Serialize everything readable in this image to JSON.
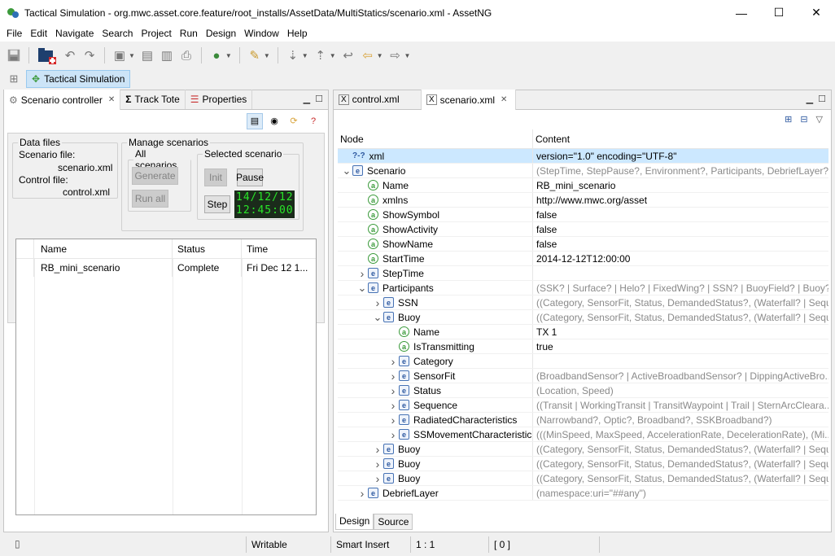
{
  "window": {
    "title": "Tactical Simulation - org.mwc.asset.core.feature/root_installs/AssetData/MultiStatics/scenario.xml - AssetNG",
    "minimize": "—",
    "maximize": "☐",
    "close": "✕"
  },
  "menu": [
    "File",
    "Edit",
    "Navigate",
    "Search",
    "Project",
    "Run",
    "Design",
    "Window",
    "Help"
  ],
  "perspective": {
    "label": "Tactical Simulation"
  },
  "left_view": {
    "tabs": [
      {
        "label": "Scenario controller",
        "active": true
      },
      {
        "label": "Track Tote",
        "active": false
      },
      {
        "label": "Properties",
        "active": false
      }
    ],
    "data_files": {
      "legend": "Data files",
      "scenario_label": "Scenario file:",
      "scenario_value": "scenario.xml",
      "control_label": "Control file:",
      "control_value": "control.xml"
    },
    "manage": {
      "legend": "Manage scenarios",
      "all_legend": "All scenarios",
      "generate": "Generate",
      "run_all": "Run all",
      "selected_legend": "Selected scenario",
      "init": "Init",
      "pause": "Pause",
      "step": "Step",
      "date": "14/12/12",
      "time": "12:45:00"
    },
    "table": {
      "columns": [
        "Name",
        "Status",
        "Time"
      ],
      "rows": [
        {
          "name": "RB_mini_scenario",
          "status": "Complete",
          "time": "Fri Dec 12 1..."
        }
      ]
    }
  },
  "editor": {
    "tabs": [
      {
        "label": "control.xml",
        "active": false
      },
      {
        "label": "scenario.xml",
        "active": true
      }
    ],
    "columns": [
      "Node",
      "Content"
    ],
    "rows": [
      {
        "depth": 0,
        "twisty": "",
        "kind": "pi",
        "name": "xml",
        "content": "version=\"1.0\" encoding=\"UTF-8\"",
        "grey": false,
        "selected": true
      },
      {
        "depth": 0,
        "twisty": "open",
        "kind": "elem",
        "name": "Scenario",
        "content": "(StepTime, StepPause?, Environment?, Participants, DebriefLayer?)",
        "grey": true
      },
      {
        "depth": 1,
        "twisty": "",
        "kind": "attr",
        "name": "Name",
        "content": "RB_mini_scenario",
        "grey": false
      },
      {
        "depth": 1,
        "twisty": "",
        "kind": "attr",
        "name": "xmlns",
        "content": "http://www.mwc.org/asset",
        "grey": false
      },
      {
        "depth": 1,
        "twisty": "",
        "kind": "attr",
        "name": "ShowSymbol",
        "content": "false",
        "grey": false
      },
      {
        "depth": 1,
        "twisty": "",
        "kind": "attr",
        "name": "ShowActivity",
        "content": "false",
        "grey": false
      },
      {
        "depth": 1,
        "twisty": "",
        "kind": "attr",
        "name": "ShowName",
        "content": "false",
        "grey": false
      },
      {
        "depth": 1,
        "twisty": "",
        "kind": "attr",
        "name": "StartTime",
        "content": "2014-12-12T12:00:00",
        "grey": false
      },
      {
        "depth": 1,
        "twisty": "closed",
        "kind": "elem",
        "name": "StepTime",
        "content": "",
        "grey": false
      },
      {
        "depth": 1,
        "twisty": "open",
        "kind": "elem",
        "name": "Participants",
        "content": "(SSK? | Surface? | Helo? | FixedWing? | SSN? | BuoyField? | Buoy? | T...",
        "grey": true
      },
      {
        "depth": 2,
        "twisty": "closed",
        "kind": "elem",
        "name": "SSN",
        "content": "((Category, SensorFit, Status, DemandedStatus?, (Waterfall? | Sequ...",
        "grey": true
      },
      {
        "depth": 2,
        "twisty": "open",
        "kind": "elem",
        "name": "Buoy",
        "content": "((Category, SensorFit, Status, DemandedStatus?, (Waterfall? | Sequ...",
        "grey": true
      },
      {
        "depth": 3,
        "twisty": "",
        "kind": "attr",
        "name": "Name",
        "content": "TX 1",
        "grey": false
      },
      {
        "depth": 3,
        "twisty": "",
        "kind": "attr",
        "name": "IsTransmitting",
        "content": "true",
        "grey": false
      },
      {
        "depth": 3,
        "twisty": "closed",
        "kind": "elem",
        "name": "Category",
        "content": "",
        "grey": false
      },
      {
        "depth": 3,
        "twisty": "closed",
        "kind": "elem",
        "name": "SensorFit",
        "content": "(BroadbandSensor? | ActiveBroadbandSensor? | DippingActiveBro...",
        "grey": true
      },
      {
        "depth": 3,
        "twisty": "closed",
        "kind": "elem",
        "name": "Status",
        "content": "(Location, Speed)",
        "grey": true
      },
      {
        "depth": 3,
        "twisty": "closed",
        "kind": "elem",
        "name": "Sequence",
        "content": "((Transit | WorkingTransit | TransitWaypoint | Trail | SternArcCleara...",
        "grey": true
      },
      {
        "depth": 3,
        "twisty": "closed",
        "kind": "elem",
        "name": "RadiatedCharacteristics",
        "content": "(Narrowband?, Optic?, Broadband?, SSKBroadband?)",
        "grey": true
      },
      {
        "depth": 3,
        "twisty": "closed",
        "kind": "elem",
        "name": "SSMovementCharacteristic",
        "content": "(((MinSpeed, MaxSpeed, AccelerationRate, DecelerationRate), (Mi...",
        "grey": true
      },
      {
        "depth": 2,
        "twisty": "closed",
        "kind": "elem",
        "name": "Buoy",
        "content": "((Category, SensorFit, Status, DemandedStatus?, (Waterfall? | Sequ...",
        "grey": true
      },
      {
        "depth": 2,
        "twisty": "closed",
        "kind": "elem",
        "name": "Buoy",
        "content": "((Category, SensorFit, Status, DemandedStatus?, (Waterfall? | Sequ...",
        "grey": true
      },
      {
        "depth": 2,
        "twisty": "closed",
        "kind": "elem",
        "name": "Buoy",
        "content": "((Category, SensorFit, Status, DemandedStatus?, (Waterfall? | Sequ...",
        "grey": true
      },
      {
        "depth": 1,
        "twisty": "closed",
        "kind": "elem",
        "name": "DebriefLayer",
        "content": "(namespace:uri=\"##any\")",
        "grey": true
      }
    ],
    "bottom_tabs": [
      {
        "label": "Design",
        "active": true
      },
      {
        "label": "Source",
        "active": false
      }
    ]
  },
  "status": {
    "writable": "Writable",
    "insert_mode": "Smart Insert",
    "position": "1 : 1",
    "selection": "[ 0 ]"
  }
}
